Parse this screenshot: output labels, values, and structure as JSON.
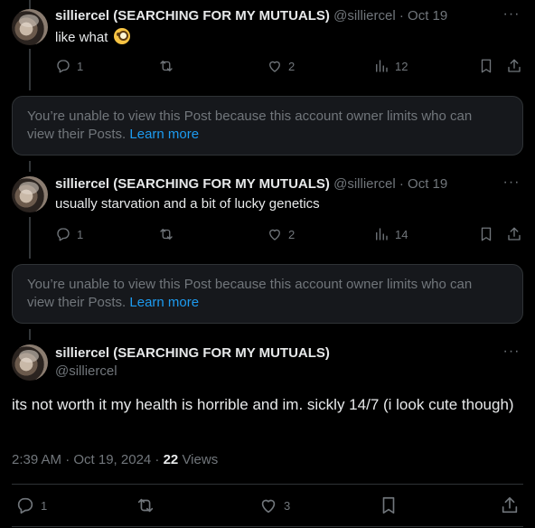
{
  "replies": [
    {
      "display_name": "silliercel (SEARCHING FOR MY MUTUALS)",
      "handle": "@silliercel",
      "separator": "·",
      "date": "Oct 19",
      "text": "like what",
      "emoji": "face-with-monocle",
      "replies": "1",
      "likes": "2",
      "views": "12"
    },
    {
      "display_name": "silliercel (SEARCHING FOR MY MUTUALS)",
      "handle": "@silliercel",
      "separator": "·",
      "date": "Oct 19",
      "text": "usually starvation and a bit of lucky genetics",
      "replies": "1",
      "likes": "2",
      "views": "14"
    }
  ],
  "notice": {
    "line1": "You’re unable to view this Post because this account owner limits who can",
    "line2_prefix": "view their Posts.",
    "link": "Learn more"
  },
  "main_post": {
    "display_name": "silliercel (SEARCHING FOR MY MUTUALS)",
    "handle": "@silliercel",
    "text": "its not worth it my health is horrible and im. sickly 14/7 (i look cute though)",
    "time": "2:39 AM · Oct 19, 2024 ·",
    "views_count": "22",
    "views_label": "Views",
    "replies": "1",
    "likes": "3"
  },
  "icons": {
    "reply": "reply-icon",
    "repost": "repost-icon",
    "like": "heart-icon",
    "views": "views-chart-icon",
    "bookmark": "bookmark-icon",
    "share": "share-icon",
    "more": "more-dots-icon"
  },
  "colors": {
    "background": "#000000",
    "text": "#e7e9ea",
    "muted": "#71767b",
    "link": "#1d9bf0",
    "notice_bg": "#16181c",
    "border": "#2f3336"
  }
}
